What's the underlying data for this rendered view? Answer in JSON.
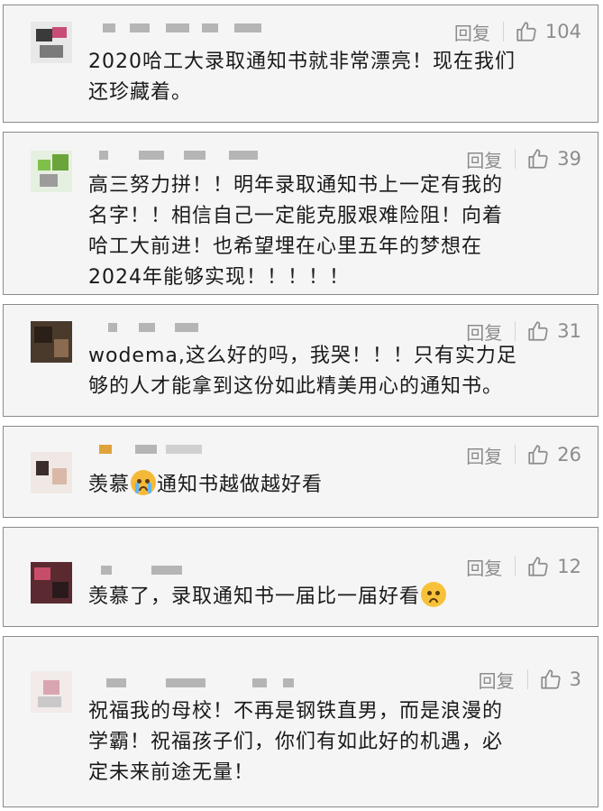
{
  "reply_label": "回复",
  "comments": [
    {
      "likes": "104",
      "lines": [
        "2020哈工大录取通知书就非常漂亮！现在我们",
        "还珍藏着。"
      ]
    },
    {
      "likes": "39",
      "lines": [
        "高三努力拼！！明年录取通知书上一定有我的",
        "名字！！相信自己一定能克服艰难险阻！向着",
        "哈工大前进！也希望埋在心里五年的梦想在",
        "2024年能够实现！！！！！"
      ]
    },
    {
      "likes": "31",
      "lines": [
        "wodema,这么好的吗，我哭！！！只有实力足",
        "够的人才能拿到这份如此精美用心的通知书。"
      ]
    },
    {
      "likes": "26",
      "text_before": "羡慕",
      "text_after": "通知书越做越好看",
      "emoji": "loudly-crying-face"
    },
    {
      "likes": "12",
      "text_before": "羡慕了，录取通知书一届比一届好看",
      "text_after": "",
      "emoji": "pleading-face"
    },
    {
      "likes": "3",
      "lines": [
        "祝福我的母校！不再是钢铁直男，而是浪漫的",
        "学霸！祝福孩子们，你们有如此好的机遇，必",
        "定未来前途无量！"
      ]
    }
  ]
}
